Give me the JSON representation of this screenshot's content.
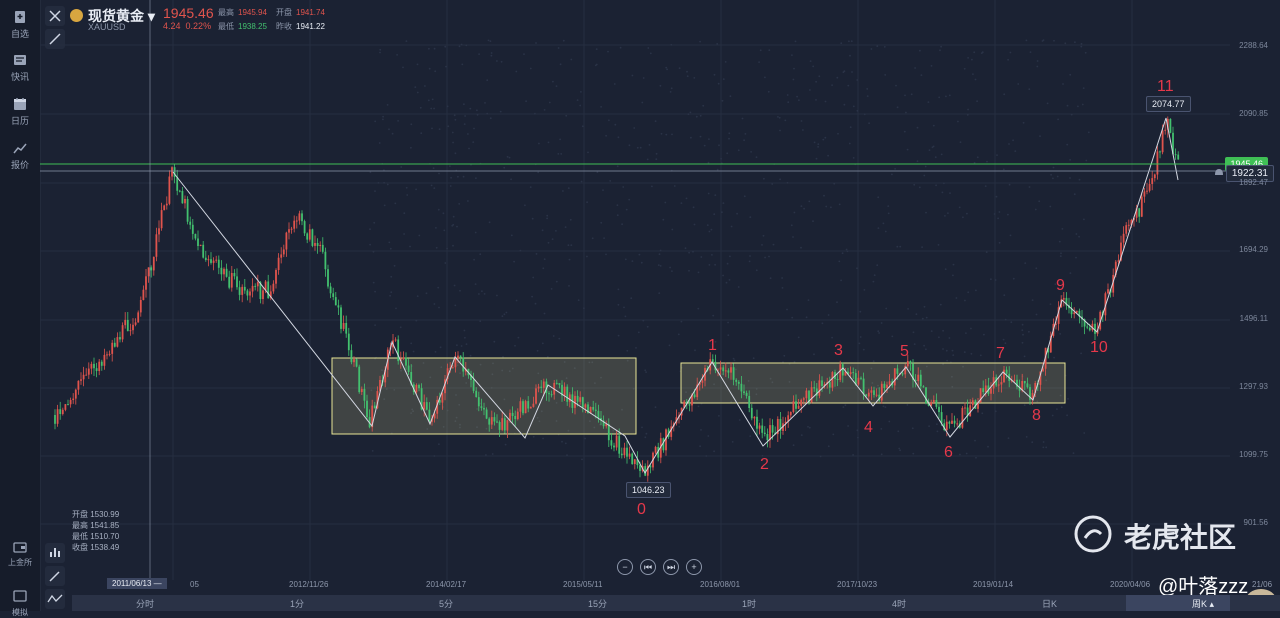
{
  "sidebar": {
    "items": [
      {
        "label": "自选",
        "icon": "bookmark-icon"
      },
      {
        "label": "快讯",
        "icon": "news-icon"
      },
      {
        "label": "日历",
        "icon": "calendar-icon"
      },
      {
        "label": "报价",
        "icon": "chart-line-icon"
      }
    ],
    "bottom_items": [
      {
        "label": "上金所",
        "icon": "wallet-icon"
      },
      {
        "label": "模拟",
        "icon": "simulate-icon"
      }
    ]
  },
  "header": {
    "title": "现货黄金",
    "symbol": "XAUUSD",
    "price": "1945.46",
    "change": "4.24",
    "change_pct": "0.22%",
    "high_label": "最高",
    "high": "1945.94",
    "open_label": "开盘",
    "open": "1941.74",
    "low_label": "最低",
    "low": "1938.25",
    "prev_label": "昨收",
    "prev_close": "1941.22"
  },
  "ohlc_box": {
    "open": "开盘 1530.99",
    "high": "最高 1541.85",
    "low": "最低 1510.70",
    "close": "收盘 1538.49"
  },
  "y_axis": [
    "2288.64",
    "2090.85",
    "1945.46",
    "1922.31",
    "1892.47",
    "1694.29",
    "1496.11",
    "1297.93",
    "1099.75",
    "901.56"
  ],
  "x_axis": [
    "2011/06/13 —",
    "05",
    "2012/11/26",
    "2014/02/17",
    "2015/05/11",
    "2016/08/01",
    "2017/10/23",
    "2019/01/14",
    "2020/04/06",
    "21/06"
  ],
  "price_tags": {
    "current": "1945.46",
    "crosshair": "1922.31",
    "low_point": "1046.23",
    "high_point": "2074.77"
  },
  "wave_labels": [
    "0",
    "1",
    "2",
    "3",
    "4",
    "5",
    "6",
    "7",
    "8",
    "9",
    "10",
    "11"
  ],
  "timebar": [
    "分时",
    "1分",
    "5分",
    "15分",
    "1时",
    "4时",
    "日K",
    "周K ▴"
  ],
  "nav_buttons": [
    "−",
    "⏮",
    "⏭",
    "+"
  ],
  "watermark": {
    "brand": "老虎社区",
    "user": "@叶落zzz"
  },
  "colors": {
    "up": "#e0544d",
    "down": "#43c16f",
    "box": "#e8e596",
    "wave": "#e5384a"
  }
}
